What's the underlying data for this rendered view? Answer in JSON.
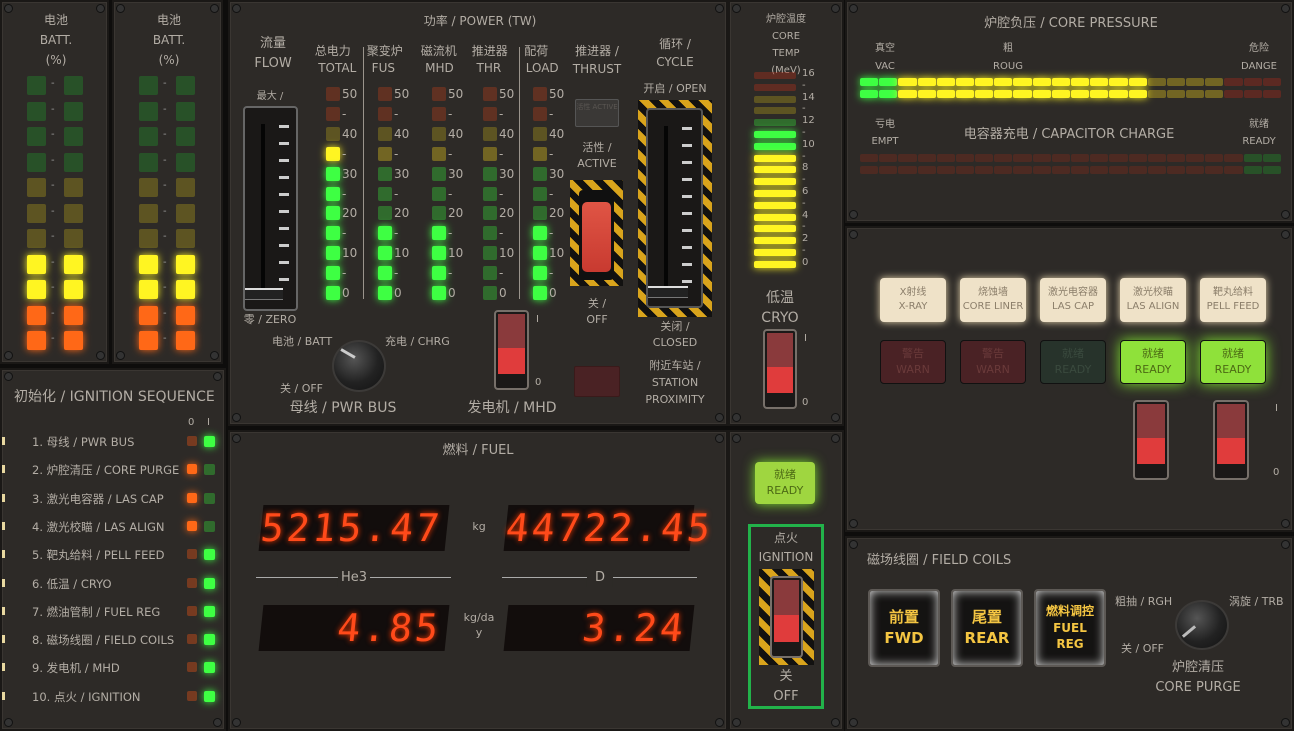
{
  "battery_panels": [
    {
      "zh": "电池",
      "en": "BATT.",
      "unit": "(%)",
      "lit": 4
    },
    {
      "zh": "电池",
      "en": "BATT.",
      "unit": "(%)",
      "lit": 4
    }
  ],
  "battery_colors": [
    "#1f9a2a",
    "#1f9a2a",
    "#1f9a2a",
    "#1f9a2a",
    "#b6a21a",
    "#b6a21a",
    "#b6a21a",
    "#f3d51e",
    "#f3d51e",
    "#ff5a14",
    "#ff5a14"
  ],
  "ignition_sequence": {
    "title": "初始化 / IGNITION SEQUENCE",
    "col_off": "0",
    "col_on": "I",
    "items": [
      {
        "label": "1. 母线 / PWR BUS",
        "on": true
      },
      {
        "label": "2. 炉腔清压 / CORE PURGE",
        "on": false
      },
      {
        "label": "3. 激光电容器 / LAS CAP",
        "on": false
      },
      {
        "label": "4. 激光校瞄 / LAS ALIGN",
        "on": false
      },
      {
        "label": "5. 靶丸给料 / PELL FEED",
        "on": true
      },
      {
        "label": "6. 低温 / CRYO",
        "on": true
      },
      {
        "label": "7. 燃油管制 / FUEL REG",
        "on": true
      },
      {
        "label": "8. 磁场线圈 / FIELD COILS",
        "on": true
      },
      {
        "label": "9. 发电机 / MHD",
        "on": true
      },
      {
        "label": "10. 点火 / IGNITION",
        "on": true
      }
    ]
  },
  "power": {
    "title": "功率 / POWER (TW)",
    "flow": {
      "zh": "流量",
      "en": "FLOW",
      "max": "最大 /",
      "zero": "零 / ZERO",
      "value": 0
    },
    "scale": [
      "50",
      "-",
      "40",
      "-",
      "30",
      "-",
      "20",
      "-",
      "10",
      "-",
      "0"
    ],
    "led_colors": [
      "#c0401a",
      "#c0401a",
      "#b6a21a",
      "#f3d51e",
      "#36e53a",
      "#36e53a",
      "#36e53a",
      "#36e53a",
      "#36e53a",
      "#36e53a",
      "#36e53a"
    ],
    "meters": [
      {
        "zh": "总电力",
        "en": "TOTAL",
        "lit": 8
      },
      {
        "zh": "聚变炉",
        "en": "FUS",
        "lit": 4
      },
      {
        "zh": "磁流机",
        "en": "MHD",
        "lit": 4
      },
      {
        "zh": "推进器",
        "en": "THR",
        "lit": 0
      },
      {
        "zh": "配荷",
        "en": "LOAD",
        "lit": 4
      }
    ],
    "thrust": {
      "label": "推进器 /",
      "label2": "THRUST",
      "button": "活性 ACTIVE",
      "active_zh": "活性 /",
      "active_en": "ACTIVE",
      "off_zh": "关 /",
      "off_en": "OFF"
    },
    "cycle": {
      "zh": "循环 /",
      "en": "CYCLE",
      "open": "开启 / OPEN",
      "closed_zh": "关闭 /",
      "closed_en": "CLOSED",
      "value": 0
    },
    "pwr_bus": {
      "title": "母线 / PWR BUS",
      "batt": "电池 / BATT",
      "chrg": "充电 / CHRG",
      "off": "关 / OFF"
    },
    "mhd": {
      "title": "发电机 / MHD",
      "on": "I",
      "off": "0"
    },
    "station": {
      "zh": "附近车站 /",
      "en1": "STATION",
      "en2": "PROXIMITY"
    }
  },
  "core_temp": {
    "zh": "炉腔温度",
    "en1": "CORE",
    "en2": "TEMP",
    "unit": "(MeV)",
    "scale": [
      "16",
      "-",
      "14",
      "-",
      "12",
      "-",
      "10",
      "-",
      "8",
      "-",
      "6",
      "-",
      "4",
      "-",
      "2",
      "-",
      "0"
    ],
    "colors": [
      "#c0301a",
      "#c0301a",
      "#b6a21a",
      "#b6a21a",
      "#36e53a",
      "#36e53a",
      "#36e53a",
      "#f3d51e",
      "#f3d51e",
      "#f3d51e",
      "#f3d51e",
      "#f3d51e",
      "#f3d51e",
      "#f3d51e",
      "#f3d51e",
      "#f3d51e",
      "#f3d51e"
    ],
    "lit": 12,
    "cryo_zh": "低温",
    "cryo_en": "CRYO",
    "on": "I",
    "off": "0"
  },
  "core_pressure": {
    "title": "炉腔负压 / CORE PRESSURE",
    "vac_zh": "真空",
    "vac_en": "VAC",
    "roug_zh": "粗",
    "roug_en": "ROUG",
    "danger_zh": "危险",
    "danger_en": "DANGE",
    "segments": 22,
    "green": 2,
    "red": 3,
    "lit": 15
  },
  "capacitor": {
    "title": "电容器充电 / CAPACITOR CHARGE",
    "empty_zh": "亏电",
    "empty_en": "EMPT",
    "ready_zh": "就绪",
    "ready_en": "READY",
    "segments": 22,
    "green": 2,
    "lit": 0
  },
  "systems": {
    "buttons": [
      {
        "zh": "X射线",
        "en": "X-RAY"
      },
      {
        "zh": "烧蚀墙",
        "en": "CORE LINER"
      },
      {
        "zh": "激光电容器",
        "en": "LAS CAP"
      },
      {
        "zh": "激光校瞄",
        "en": "LAS ALIGN"
      },
      {
        "zh": "靶丸给料",
        "en": "PELL FEED"
      }
    ],
    "status": [
      {
        "zh": "警告",
        "en": "WARN",
        "state": "warn-off"
      },
      {
        "zh": "警告",
        "en": "WARN",
        "state": "warn-off"
      },
      {
        "zh": "就绪",
        "en": "READY",
        "state": "ready-off"
      },
      {
        "zh": "就绪",
        "en": "READY",
        "state": "ready-on"
      },
      {
        "zh": "就绪",
        "en": "READY",
        "state": "ready-on"
      }
    ],
    "switch_on": "I",
    "switch_off": "0"
  },
  "fuel": {
    "title": "燃料 / FUEL",
    "he3_label": "He3",
    "d_label": "D",
    "he3_mass": "5215.47",
    "d_mass": "44722.45",
    "mass_unit": "kg",
    "he3_rate": "4.85",
    "d_rate": "3.24",
    "rate_unit": "kg/day"
  },
  "ignition": {
    "ready_zh": "就绪",
    "ready_en": "READY",
    "zh": "点火",
    "en": "IGNITION",
    "off_zh": "关",
    "off_en": "OFF"
  },
  "field_coils": {
    "title": "磁场线圈 / FIELD COILS",
    "buttons": [
      {
        "zh": "前置",
        "en": "FWD"
      },
      {
        "zh": "尾置",
        "en": "REAR"
      },
      {
        "zh": "燃料调控",
        "en": "FUEL REG"
      }
    ],
    "purge_rgh": "粗抽 / RGH",
    "purge_trb": "涡旋 / TRB",
    "purge_off": "关 / OFF",
    "purge_zh": "炉腔清压",
    "purge_en": "CORE PURGE"
  }
}
